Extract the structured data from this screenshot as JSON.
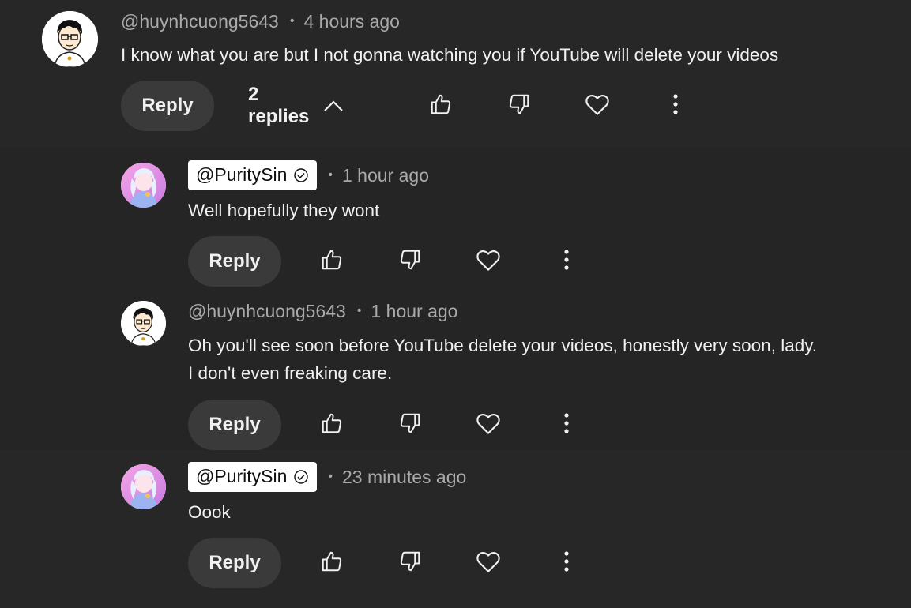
{
  "comments": [
    {
      "author": "@huynhcuong5643",
      "time": "4 hours ago",
      "lines": [
        "I know what you are but I not gonna watching you if YouTube will delete your videos"
      ],
      "reply_label": "Reply",
      "replies_label": "2 replies",
      "avatar": "cartoon-boy"
    },
    {
      "author": "@PuritySin",
      "time": "1 hour ago",
      "lines": [
        "Well hopefully they wont"
      ],
      "reply_label": "Reply",
      "avatar": "anime-girl"
    },
    {
      "author": "@huynhcuong5643",
      "time": "1 hour ago",
      "lines": [
        "Oh you'll see soon before YouTube delete your videos, honestly very soon, lady.",
        "I don't even freaking care."
      ],
      "reply_label": "Reply",
      "avatar": "cartoon-boy"
    },
    {
      "author": "@PuritySin",
      "time": "23 minutes ago",
      "lines": [
        "Oook"
      ],
      "reply_label": "Reply",
      "avatar": "anime-girl"
    }
  ],
  "separator": "•",
  "icons": {
    "like": "thumbs-up-icon",
    "dislike": "thumbs-down-icon",
    "heart": "heart-icon",
    "more": "more-vert-icon",
    "collapse": "chevron-up-icon",
    "verified": "verified-check-icon"
  },
  "colors": {
    "background": "#272727",
    "primary_text": "#f1f1f1",
    "secondary_text": "#aaaaaa",
    "button_bg": "#3a3a3a",
    "creator_chip_bg": "#ffffff"
  }
}
